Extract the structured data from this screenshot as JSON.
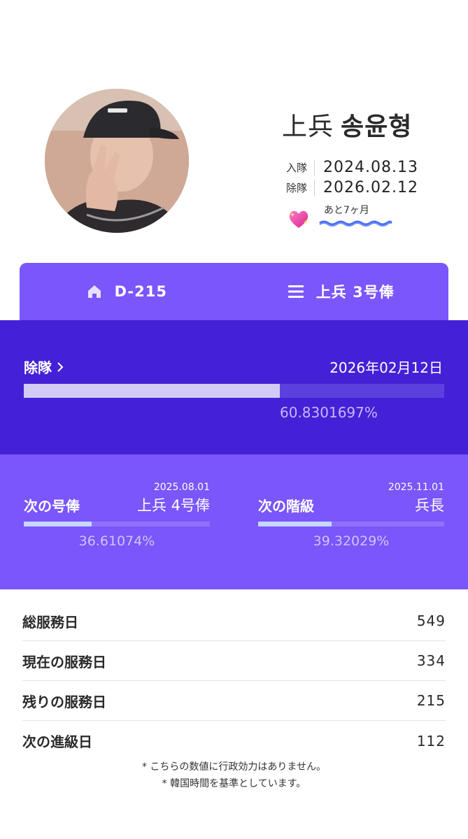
{
  "profile": {
    "rank": "上兵",
    "name": "송윤형",
    "enlist_label": "入隊",
    "enlist_date": "2024.08.13",
    "discharge_label": "除隊",
    "discharge_date": "2026.02.12",
    "remaining_text": "あと7ヶ月",
    "heart_icon": "sparkling-heart-icon"
  },
  "tabs": [
    {
      "icon": "home-icon",
      "label": "D-215"
    },
    {
      "icon": "menu-icon",
      "label": "上兵 3号俸"
    }
  ],
  "discharge": {
    "title": "除隊",
    "date": "2026年02月12日",
    "progress": 0.608301697,
    "percent_text": "60.8301697%"
  },
  "next": [
    {
      "title": "次の号俸",
      "date": "2025.08.01",
      "target": "上兵 4号俸",
      "progress": 0.3661074,
      "percent_text": "36.61074%"
    },
    {
      "title": "次の階級",
      "date": "2025.11.01",
      "target": "兵長",
      "progress": 0.3932029,
      "percent_text": "39.32029%"
    }
  ],
  "stats": [
    {
      "label": "総服務日",
      "value": "549"
    },
    {
      "label": "現在の服務日",
      "value": "334"
    },
    {
      "label": "残りの服務日",
      "value": "215"
    },
    {
      "label": "次の進級日",
      "value": "112"
    }
  ],
  "notes": [
    "* こちらの数値に行政効力はありません。",
    "* 韓国時間を基準としています。"
  ],
  "colors": {
    "accent": "#7a56fb",
    "dark_accent": "#4421d6",
    "progress_fill": "#d3cbf6",
    "small_progress_fill": "#c5d7ff"
  }
}
